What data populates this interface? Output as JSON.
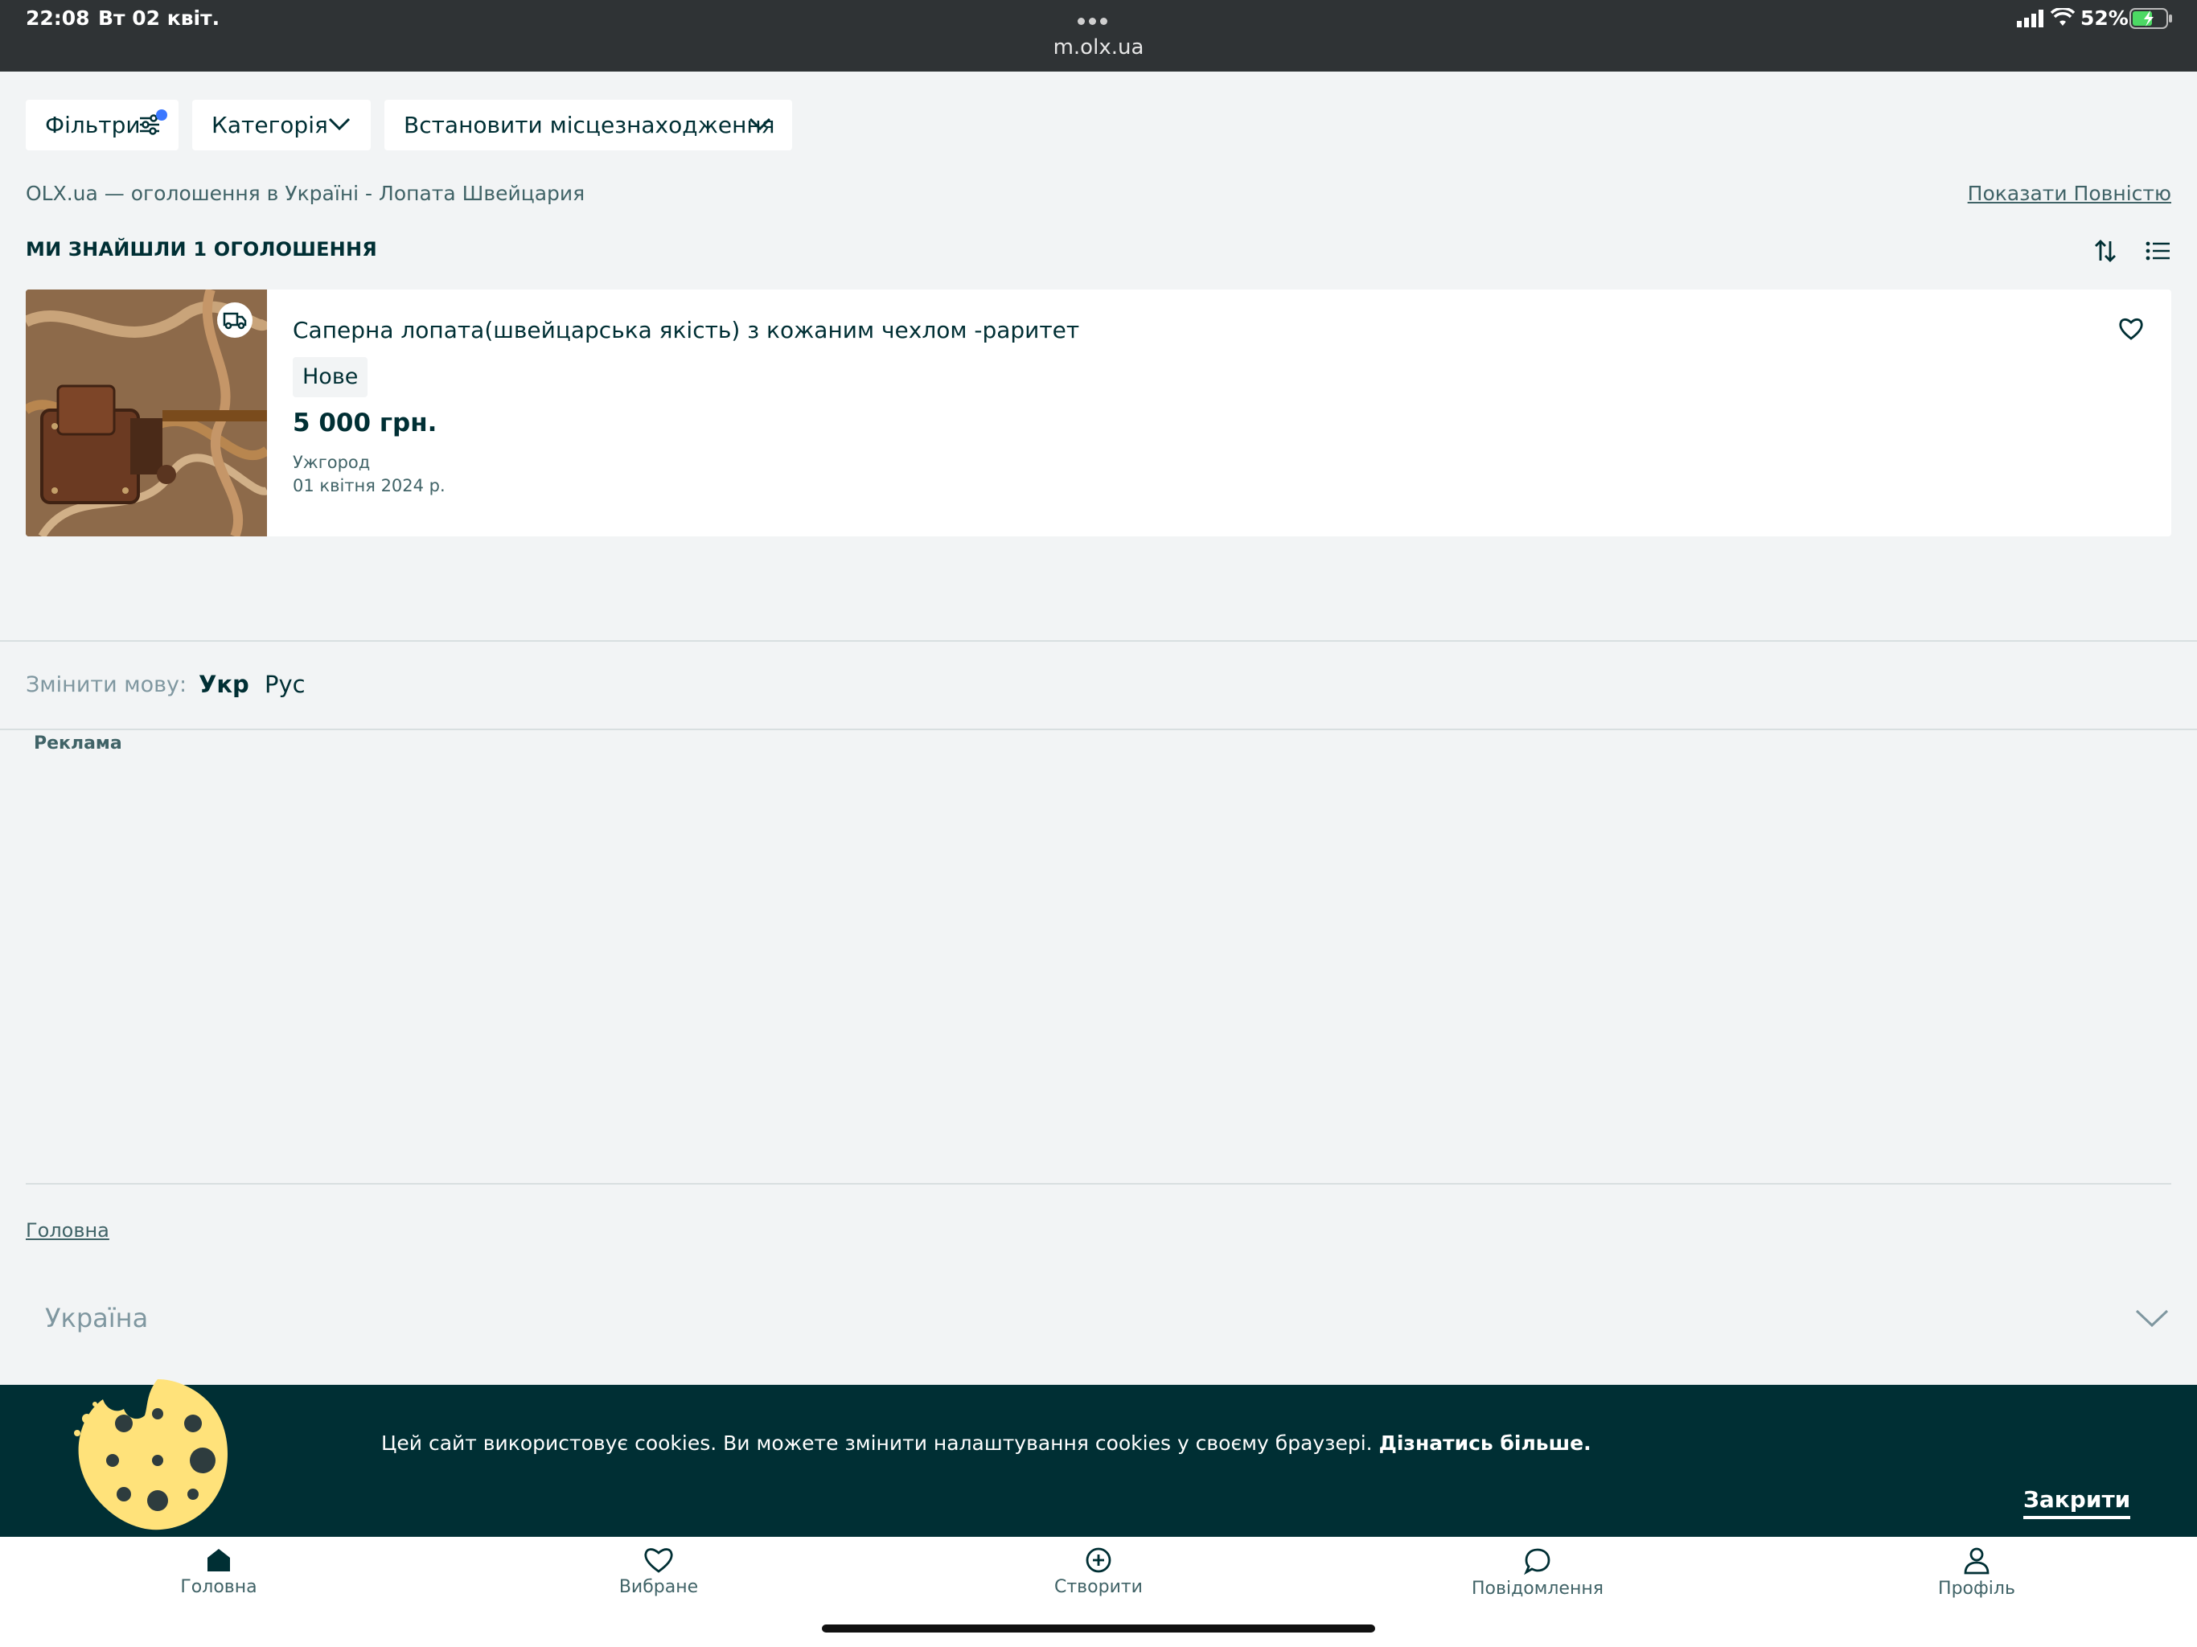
{
  "status_bar": {
    "time": "22:08",
    "date": "Вт 02 квіт.",
    "url": "m.olx.ua",
    "battery": "52%"
  },
  "filters": {
    "filters_label": "Фільтри",
    "category_label": "Категорія",
    "location_label": "Встановити місцезнаходження"
  },
  "breadcrumb_title": "OLX.ua — оголошення в Україні - Лопата Швейцария",
  "show_full_label": "Показати Повністю",
  "results": {
    "found_label": "МИ ЗНАЙШЛИ 1 ОГОЛОШЕННЯ"
  },
  "listing": {
    "title": "Саперна лопата(швейцарська якість) з кожаним чехлом -раритет",
    "condition": "Нове",
    "price": "5 000 грн.",
    "city": "Ужгород",
    "date": "01 квітня 2024 р."
  },
  "language": {
    "label": "Змінити мову:",
    "uk": "Укр",
    "ru": "Рус"
  },
  "ad_label": "Реклама",
  "footer": {
    "home_link": "Головна",
    "country": "Україна"
  },
  "cookie": {
    "text": "Цей сайт використовує cookies. Ви можете змінити налаштування cookies у своєму браузері.",
    "learn_more": "Дізнатись більше.",
    "close": "Закрити"
  },
  "bottom_nav": {
    "home": "Головна",
    "favorites": "Вибране",
    "create": "Створити",
    "messages": "Повідомлення",
    "profile": "Профіль"
  },
  "colors": {
    "brand_dark": "#002f34",
    "background": "#f2f4f5",
    "accent_dot": "#3a77ff"
  }
}
